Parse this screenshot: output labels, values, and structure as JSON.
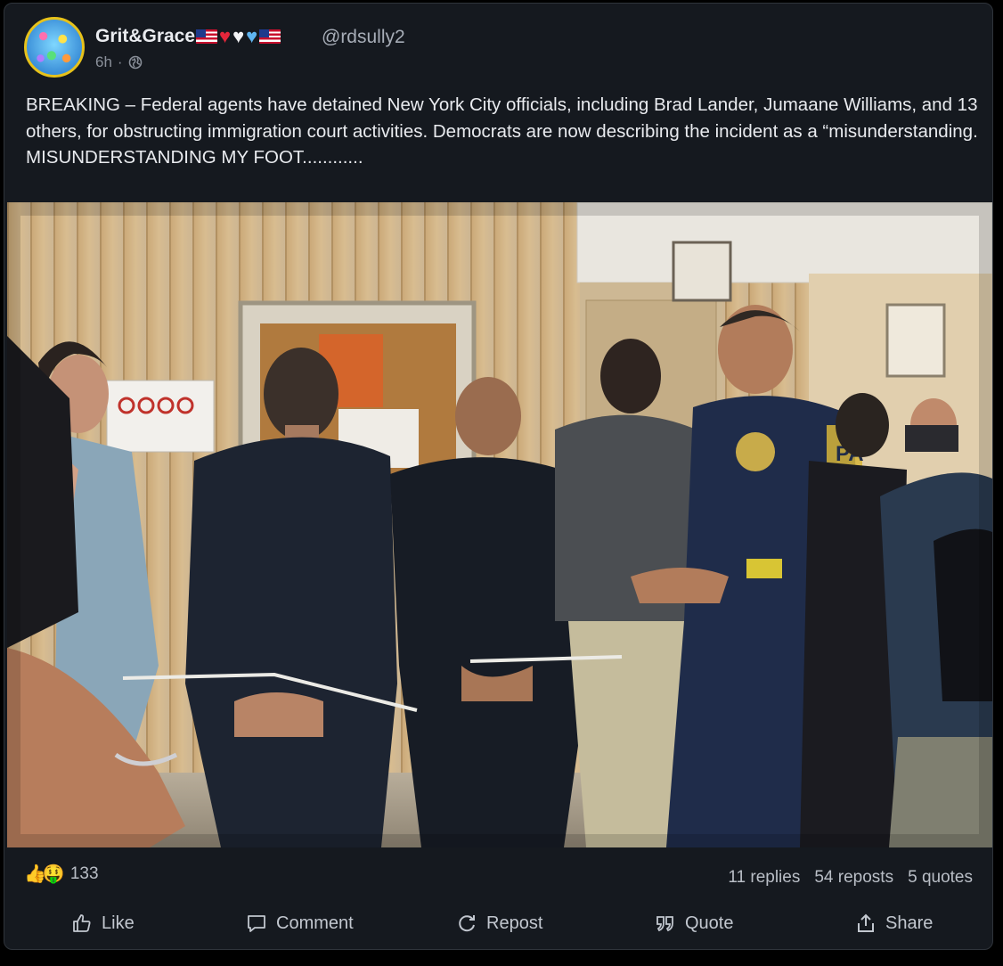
{
  "post": {
    "author_name": "Grit&Grace",
    "author_emojis": [
      "flag-us-icon",
      "red-heart",
      "white-heart",
      "blue-heart",
      "flag-us-icon"
    ],
    "handle": "@rdsully2",
    "time": "6h",
    "separator": "·",
    "visibility_icon": "globe-icon",
    "text": "BREAKING – Federal agents have detained New York City officials, including Brad Lander, Jumaane Williams, and 13 others, for obstructing immigration court activities. Democrats are now describing the incident as a “misunderstanding.\nMISUNDERSTANDING MY FOOT............",
    "image_sign_text": "PA"
  },
  "engagement": {
    "reaction_icons": [
      "thumbs-up-icon",
      "smiley-face-icon"
    ],
    "reaction_count": "133",
    "replies": "11 replies",
    "reposts": "54 reposts",
    "quotes": "5 quotes"
  },
  "actions": {
    "like": "Like",
    "comment": "Comment",
    "repost": "Repost",
    "quote": "Quote",
    "share": "Share"
  },
  "colors": {
    "card_bg": "#15191f",
    "text": "#e9ebef",
    "muted": "#a7adb7",
    "avatar_ring": "#e7c21a"
  }
}
